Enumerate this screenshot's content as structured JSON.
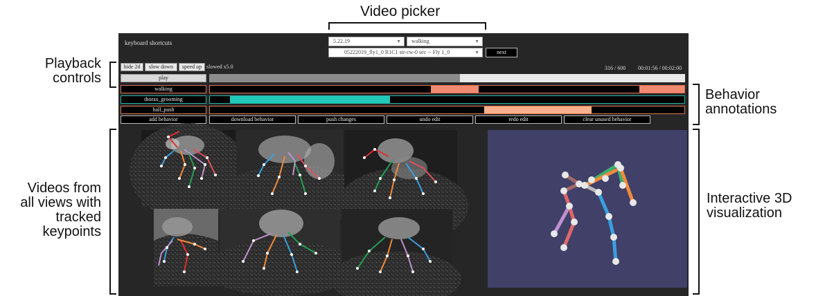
{
  "annotations": {
    "video_picker": "Video picker",
    "playback_controls": [
      "Playback",
      "controls"
    ],
    "behavior_annotations": [
      "Behavior",
      "annotations"
    ],
    "videos": [
      "Videos from",
      "all views with",
      "tracked",
      "keypoints"
    ],
    "interactive_3d": [
      "Interactive 3D",
      "visualization"
    ]
  },
  "app": {
    "keyboard_shortcuts": "keyboard shortcuts",
    "picker": {
      "date": "5.22.19",
      "behavior_filter": "walking",
      "video": "05222019_fly1_0 R1C1 str-cw-0 sec -- Fly 1_0",
      "next_label": "next"
    },
    "playback": {
      "hide_2d": "hide 2d",
      "slow_down": "slow down",
      "speed_up": "speed up",
      "speed_status": "slowed x5.0",
      "frame": "316 / 600",
      "time": "00:01:56 / 00:02:00",
      "play_label": "play",
      "progress_fraction": 0.527
    },
    "behaviors": [
      {
        "name": "walking",
        "color": "#f08a70",
        "border": "#e07050",
        "segments": [
          [
            0.465,
            0.567
          ],
          [
            0.905,
            1.0
          ]
        ]
      },
      {
        "name": "thorax_grooming",
        "color": "#22c9b8",
        "border": "#1fb3a5",
        "segments": [
          [
            0.043,
            0.38
          ]
        ]
      },
      {
        "name": "ball_push",
        "color": "#f9b08c",
        "border": "#e07a50",
        "segments": [
          [
            0.578,
            0.805
          ]
        ]
      }
    ],
    "actions": {
      "add_behavior": "add behavior",
      "download_behavior": "download behavior",
      "push_changes": "push changes",
      "undo_edit": "undo edit",
      "redo_edit": "redo edit",
      "clear_unused_behavior": "clear unused behavior"
    }
  }
}
